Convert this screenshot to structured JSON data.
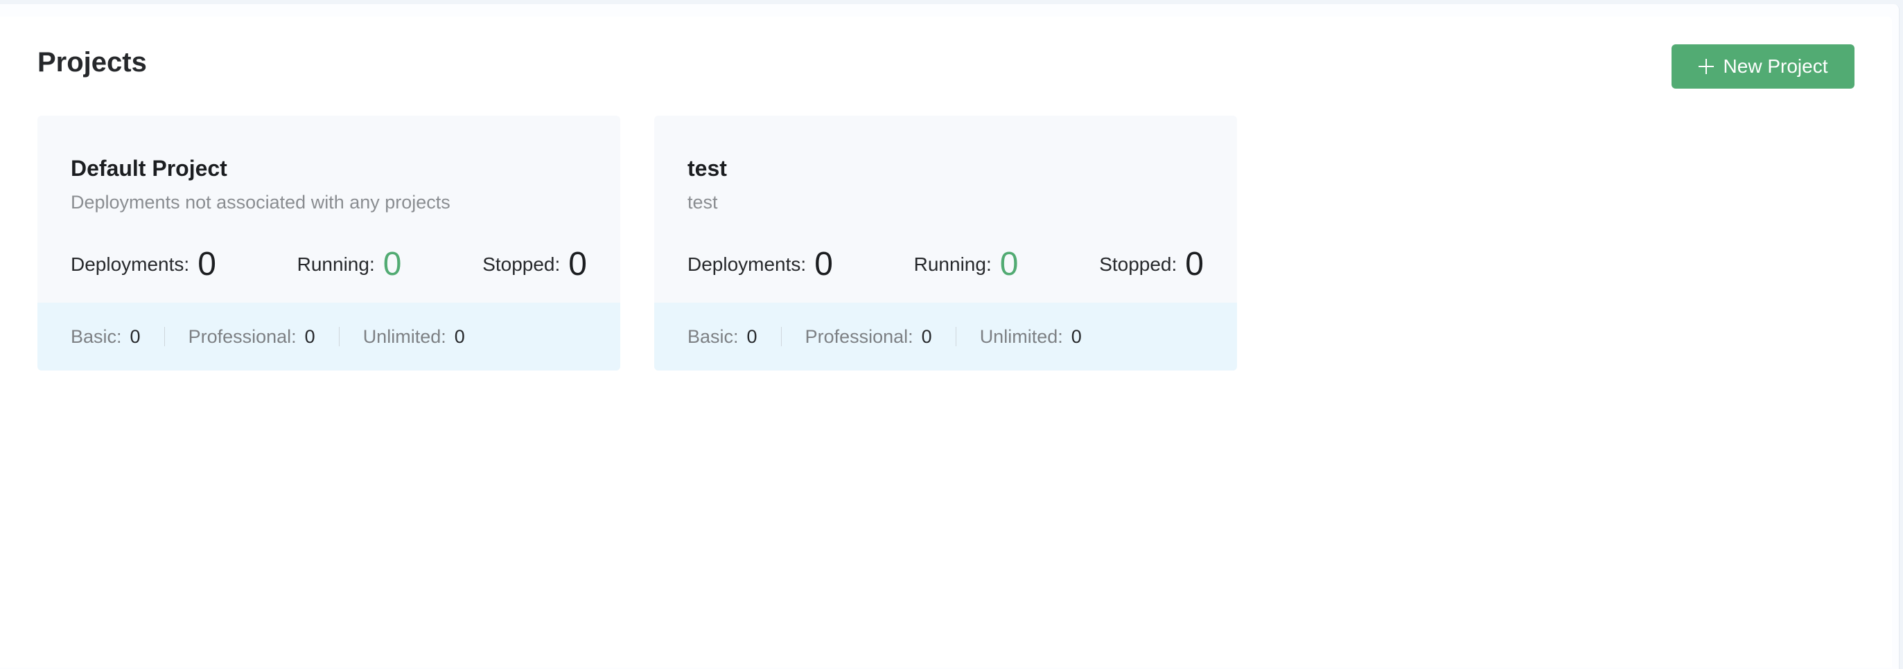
{
  "page": {
    "title": "Projects",
    "new_project_label": "New Project"
  },
  "colors": {
    "accent": "#52ab73",
    "card_background": "#f7f9fc",
    "tier_background": "#e9f6fd"
  },
  "projects": [
    {
      "name": "Default Project",
      "description": "Deployments not associated with any projects",
      "stats": {
        "deployments_label": "Deployments:",
        "deployments": "0",
        "running_label": "Running:",
        "running": "0",
        "stopped_label": "Stopped:",
        "stopped": "0"
      },
      "tiers": {
        "basic_label": "Basic:",
        "basic": "0",
        "professional_label": "Professional:",
        "professional": "0",
        "unlimited_label": "Unlimited:",
        "unlimited": "0"
      }
    },
    {
      "name": "test",
      "description": "test",
      "stats": {
        "deployments_label": "Deployments:",
        "deployments": "0",
        "running_label": "Running:",
        "running": "0",
        "stopped_label": "Stopped:",
        "stopped": "0"
      },
      "tiers": {
        "basic_label": "Basic:",
        "basic": "0",
        "professional_label": "Professional:",
        "professional": "0",
        "unlimited_label": "Unlimited:",
        "unlimited": "0"
      }
    }
  ]
}
